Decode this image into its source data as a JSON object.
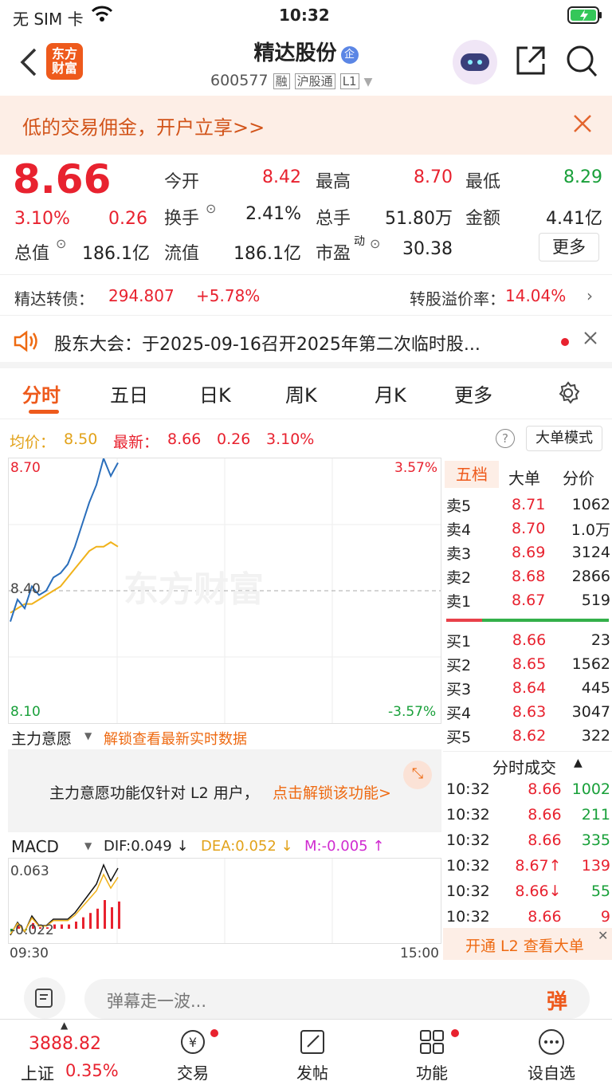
{
  "status": {
    "carrier": "无 SIM 卡",
    "time": "10:32"
  },
  "header": {
    "logo": "东方财富",
    "stock_name": "精达股份",
    "badge": "企",
    "code": "600577",
    "tags": [
      "融",
      "沪股通",
      "L1"
    ]
  },
  "promo": {
    "text": "低的交易佣金，开户立享>>"
  },
  "quote": {
    "price": "8.66",
    "change_pct": "3.10%",
    "change": "0.26",
    "cells": [
      {
        "label": "今开",
        "value": "8.42",
        "color": "#e8222f"
      },
      {
        "label": "最高",
        "value": "8.70",
        "color": "#e8222f"
      },
      {
        "label": "最低",
        "value": "8.29",
        "color": "#19a03a"
      },
      {
        "label": "换手",
        "value": "2.41%",
        "color": "#222"
      },
      {
        "label": "总手",
        "value": "51.80万",
        "color": "#222"
      },
      {
        "label": "金额",
        "value": "4.41亿",
        "color": "#222"
      },
      {
        "label": "总值",
        "value": "186.1亿",
        "color": "#222"
      },
      {
        "label": "流值",
        "value": "186.1亿",
        "color": "#222"
      },
      {
        "label": "市盈",
        "value": "30.38",
        "color": "#222"
      }
    ],
    "pe_sup": "动",
    "more": "更多"
  },
  "bond": {
    "name": "精达转债：",
    "price": "294.807",
    "pct": "+5.78%",
    "premium_label": "转股溢价率：",
    "premium": "14.04%"
  },
  "notice": {
    "text": "股东大会：于2025-09-16召开2025年第二次临时股..."
  },
  "tabs": [
    "分时",
    "五日",
    "日K",
    "周K",
    "月K",
    "更多"
  ],
  "avg": {
    "avg_label": "均价：",
    "avg": "8.50",
    "latest_label": "最新：",
    "latest": "8.66",
    "chg": "0.26",
    "pct": "3.10%",
    "mode": "大单模式"
  },
  "chart": {
    "ytop": "8.70",
    "ymid": "8.40",
    "ybot": "8.10",
    "ptop": "3.57%",
    "pbot": "-3.57%",
    "watermark": "东方财富"
  },
  "chart_data": {
    "type": "line",
    "series": [
      {
        "name": "价格",
        "values": [
          8.33,
          8.38,
          8.36,
          8.41,
          8.39,
          8.4,
          8.43,
          8.44,
          8.46,
          8.5,
          8.55,
          8.6,
          8.64,
          8.7,
          8.66,
          8.69
        ]
      },
      {
        "name": "均价",
        "values": [
          8.35,
          8.36,
          8.37,
          8.37,
          8.38,
          8.39,
          8.4,
          8.41,
          8.43,
          8.45,
          8.47,
          8.49,
          8.5,
          8.5,
          8.51,
          8.5
        ]
      }
    ],
    "ylim": [
      8.1,
      8.7
    ]
  },
  "orderbook": {
    "tabs": [
      "五档",
      "大单",
      "分价"
    ],
    "sell": [
      [
        "卖5",
        "8.71",
        "1062"
      ],
      [
        "卖4",
        "8.70",
        "1.0万"
      ],
      [
        "卖3",
        "8.69",
        "3124"
      ],
      [
        "卖2",
        "8.68",
        "2866"
      ],
      [
        "卖1",
        "8.67",
        "519"
      ]
    ],
    "buy": [
      [
        "买1",
        "8.66",
        "23"
      ],
      [
        "买2",
        "8.65",
        "1562"
      ],
      [
        "买3",
        "8.64",
        "445"
      ],
      [
        "买4",
        "8.63",
        "3047"
      ],
      [
        "买5",
        "8.62",
        "322"
      ]
    ],
    "trades_title": "分时成交",
    "trades": [
      [
        "10:32",
        "8.66",
        "1002",
        "#19a03a"
      ],
      [
        "10:32",
        "8.66",
        "211",
        "#19a03a"
      ],
      [
        "10:32",
        "8.66",
        "335",
        "#19a03a"
      ],
      [
        "10:32",
        "8.67↑",
        "139",
        "#e8222f"
      ],
      [
        "10:32",
        "8.66↓",
        "55",
        "#19a03a"
      ],
      [
        "10:32",
        "8.66",
        "9",
        "#e8222f"
      ]
    ],
    "l2": "开通 L2 查看大单"
  },
  "mainforce": {
    "label": "主力意愿",
    "unlock": "解锁查看最新实时数据",
    "tip1": "主力意愿功能仅针对 L2 用户，",
    "tip2": "点击解锁该功能>"
  },
  "macd": {
    "label": "MACD",
    "dif": "DIF:0.049 ↓",
    "dea": "DEA:0.052 ↓",
    "m": "M:-0.005 ↑",
    "top": "0.063",
    "bot": "-0.022",
    "t0": "09:30",
    "t1": "15:00"
  },
  "input": {
    "placeholder": "弹幕走一波...",
    "btn": "弹"
  },
  "tabbar": {
    "index_val": "3888.82",
    "index_name": "上证",
    "index_pct": "0.35%",
    "items": [
      "交易",
      "发帖",
      "功能",
      "设自选"
    ]
  }
}
